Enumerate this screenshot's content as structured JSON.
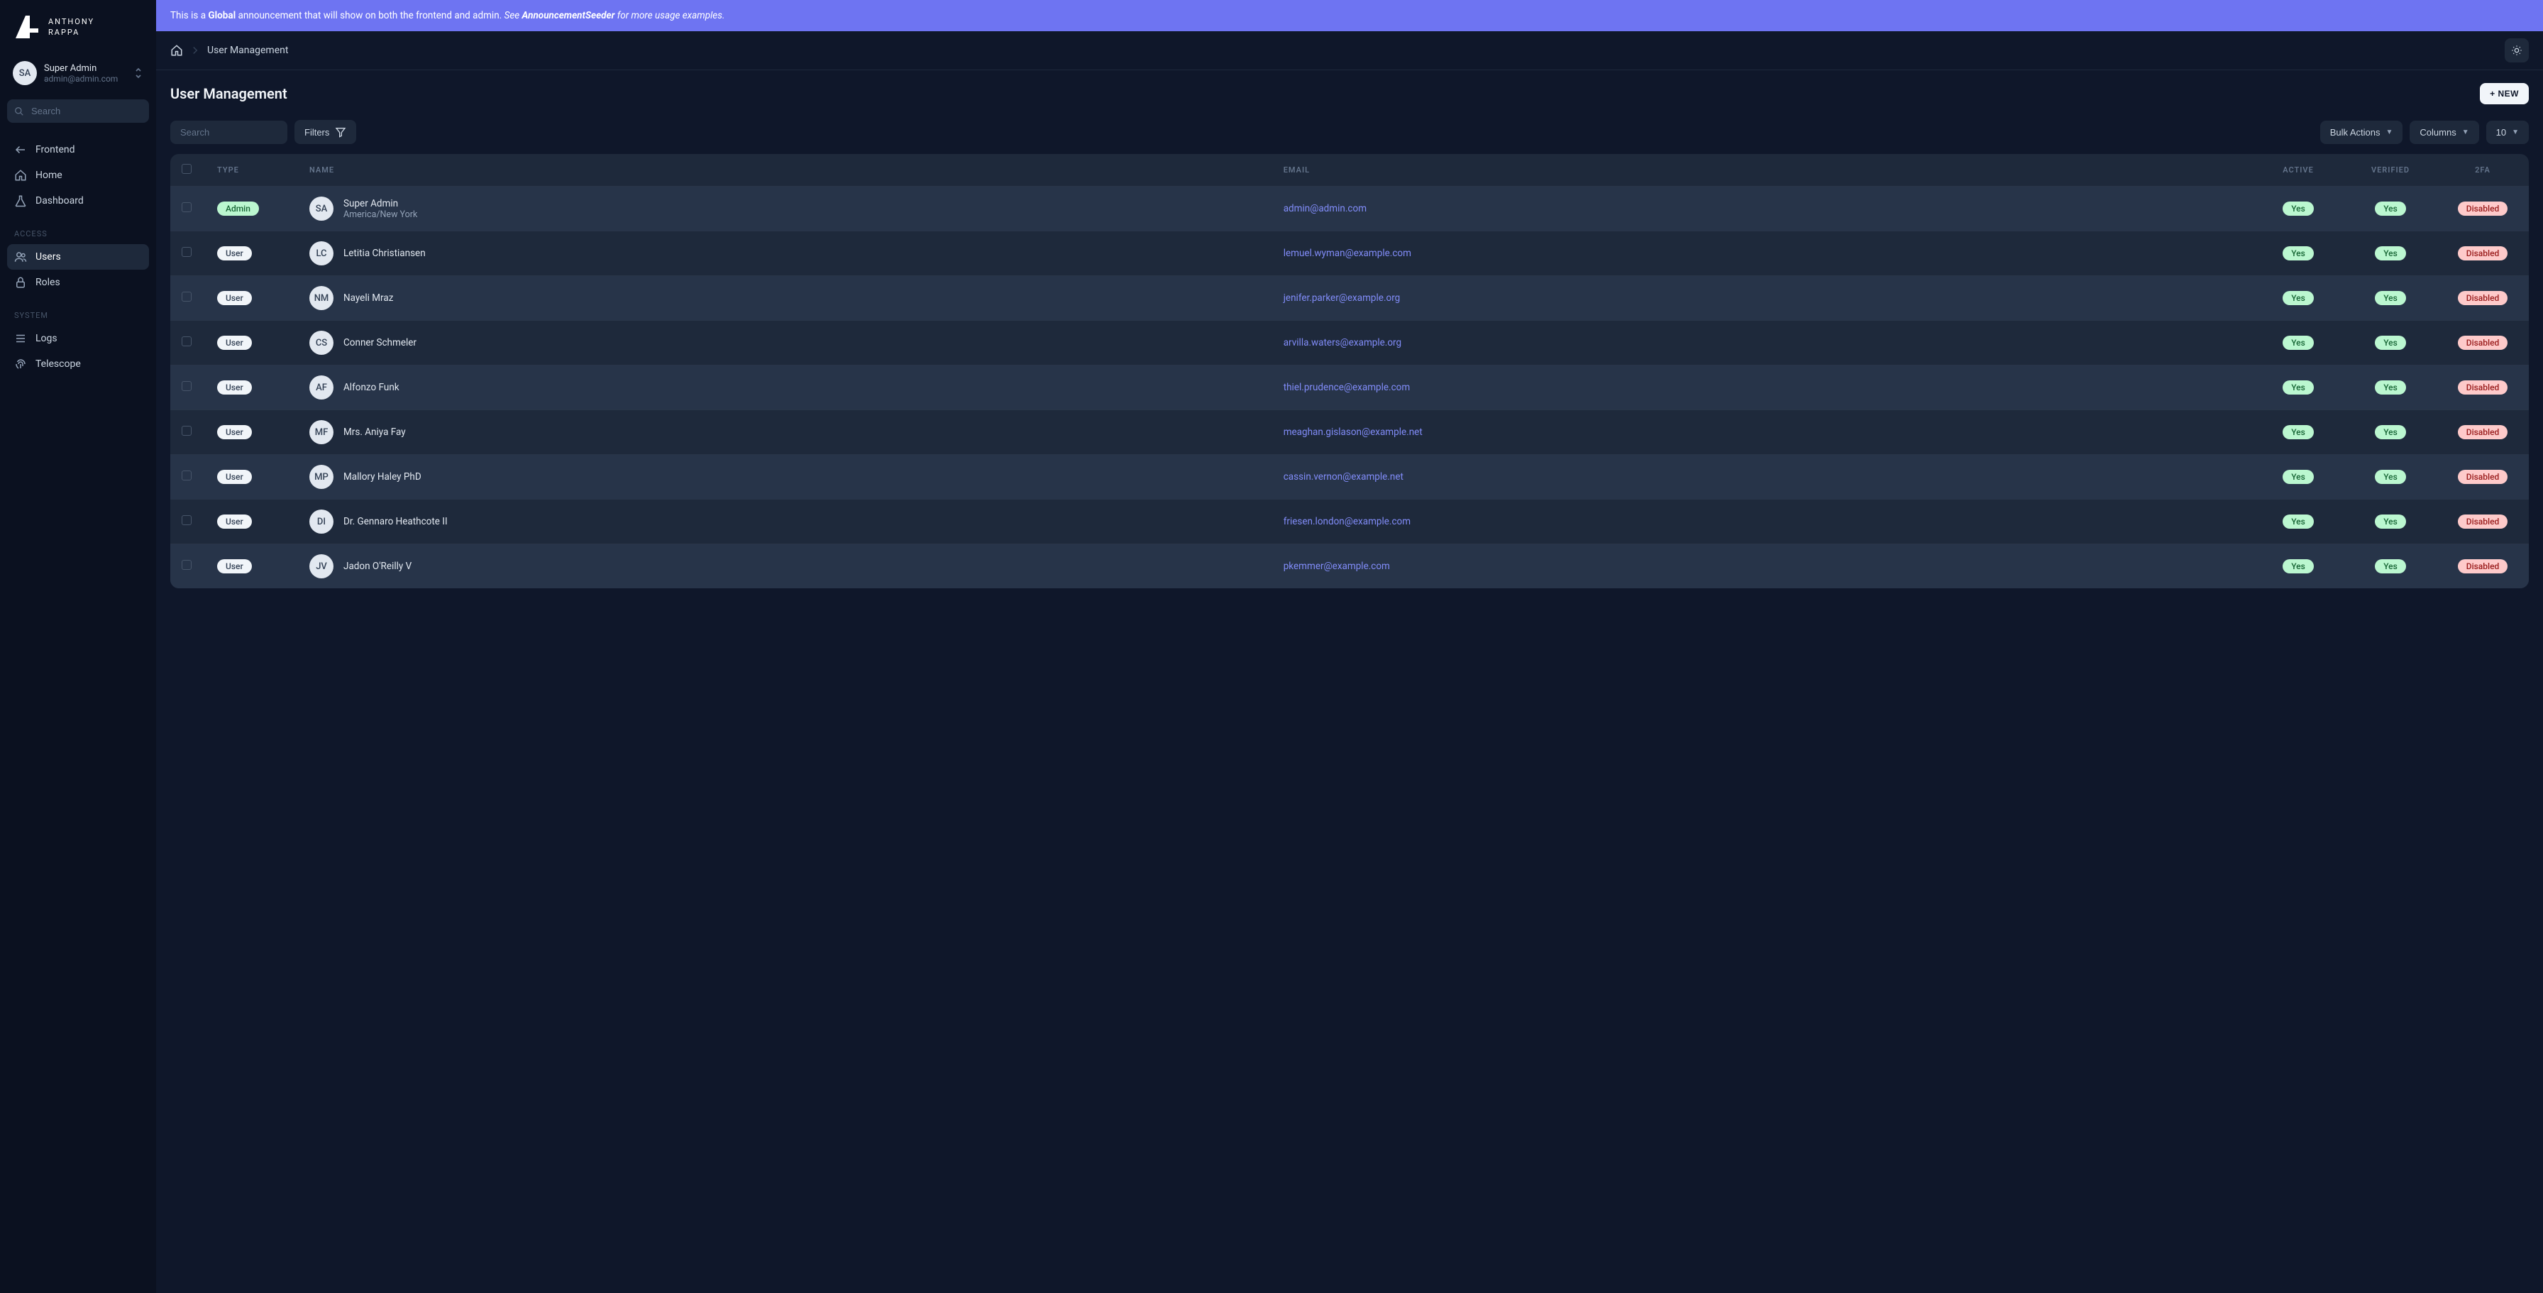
{
  "brand": {
    "line1": "ANTHONY",
    "line2": "RAPPA"
  },
  "sidebar": {
    "user": {
      "initials": "SA",
      "name": "Super Admin",
      "email": "admin@admin.com"
    },
    "search_placeholder": "Search",
    "nav_top": [
      {
        "label": "Frontend",
        "icon": "arrow-left"
      },
      {
        "label": "Home",
        "icon": "home"
      },
      {
        "label": "Dashboard",
        "icon": "flask"
      }
    ],
    "groups": [
      {
        "label": "ACCESS",
        "items": [
          {
            "label": "Users",
            "icon": "users",
            "active": true
          },
          {
            "label": "Roles",
            "icon": "lock"
          }
        ]
      },
      {
        "label": "SYSTEM",
        "items": [
          {
            "label": "Logs",
            "icon": "list"
          },
          {
            "label": "Telescope",
            "icon": "fingerprint"
          }
        ]
      }
    ]
  },
  "announcement": {
    "p1": "This is a ",
    "p2": "Global",
    "p3": " announcement that will show on both the frontend and admin. ",
    "p4": "See ",
    "p5": "AnnouncementSeeder",
    "p6": " for more usage examples."
  },
  "breadcrumb": {
    "current": "User Management"
  },
  "page": {
    "title": "User Management",
    "new_button": "+ NEW"
  },
  "toolbar": {
    "search_placeholder": "Search",
    "filters": "Filters",
    "bulk_actions": "Bulk Actions",
    "columns": "Columns",
    "page_size": "10"
  },
  "table": {
    "headers": {
      "type": "TYPE",
      "name": "NAME",
      "email": "EMAIL",
      "active": "ACTIVE",
      "verified": "VERIFIED",
      "twofa": "2FA"
    },
    "badge_labels": {
      "admin": "Admin",
      "user": "User",
      "yes": "Yes",
      "disabled": "Disabled"
    },
    "rows": [
      {
        "type": "admin",
        "initials": "SA",
        "name": "Super Admin",
        "sub": "America/New York",
        "email": "admin@admin.com",
        "active": "yes",
        "verified": "yes",
        "twofa": "disabled"
      },
      {
        "type": "user",
        "initials": "LC",
        "name": "Letitia Christiansen",
        "sub": "",
        "email": "lemuel.wyman@example.com",
        "active": "yes",
        "verified": "yes",
        "twofa": "disabled"
      },
      {
        "type": "user",
        "initials": "NM",
        "name": "Nayeli Mraz",
        "sub": "",
        "email": "jenifer.parker@example.org",
        "active": "yes",
        "verified": "yes",
        "twofa": "disabled"
      },
      {
        "type": "user",
        "initials": "CS",
        "name": "Conner Schmeler",
        "sub": "",
        "email": "arvilla.waters@example.org",
        "active": "yes",
        "verified": "yes",
        "twofa": "disabled"
      },
      {
        "type": "user",
        "initials": "AF",
        "name": "Alfonzo Funk",
        "sub": "",
        "email": "thiel.prudence@example.com",
        "active": "yes",
        "verified": "yes",
        "twofa": "disabled"
      },
      {
        "type": "user",
        "initials": "MF",
        "name": "Mrs. Aniya Fay",
        "sub": "",
        "email": "meaghan.gislason@example.net",
        "active": "yes",
        "verified": "yes",
        "twofa": "disabled"
      },
      {
        "type": "user",
        "initials": "MP",
        "name": "Mallory Haley PhD",
        "sub": "",
        "email": "cassin.vernon@example.net",
        "active": "yes",
        "verified": "yes",
        "twofa": "disabled"
      },
      {
        "type": "user",
        "initials": "DI",
        "name": "Dr. Gennaro Heathcote II",
        "sub": "",
        "email": "friesen.london@example.com",
        "active": "yes",
        "verified": "yes",
        "twofa": "disabled"
      },
      {
        "type": "user",
        "initials": "JV",
        "name": "Jadon O'Reilly V",
        "sub": "",
        "email": "pkemmer@example.com",
        "active": "yes",
        "verified": "yes",
        "twofa": "disabled"
      }
    ]
  }
}
